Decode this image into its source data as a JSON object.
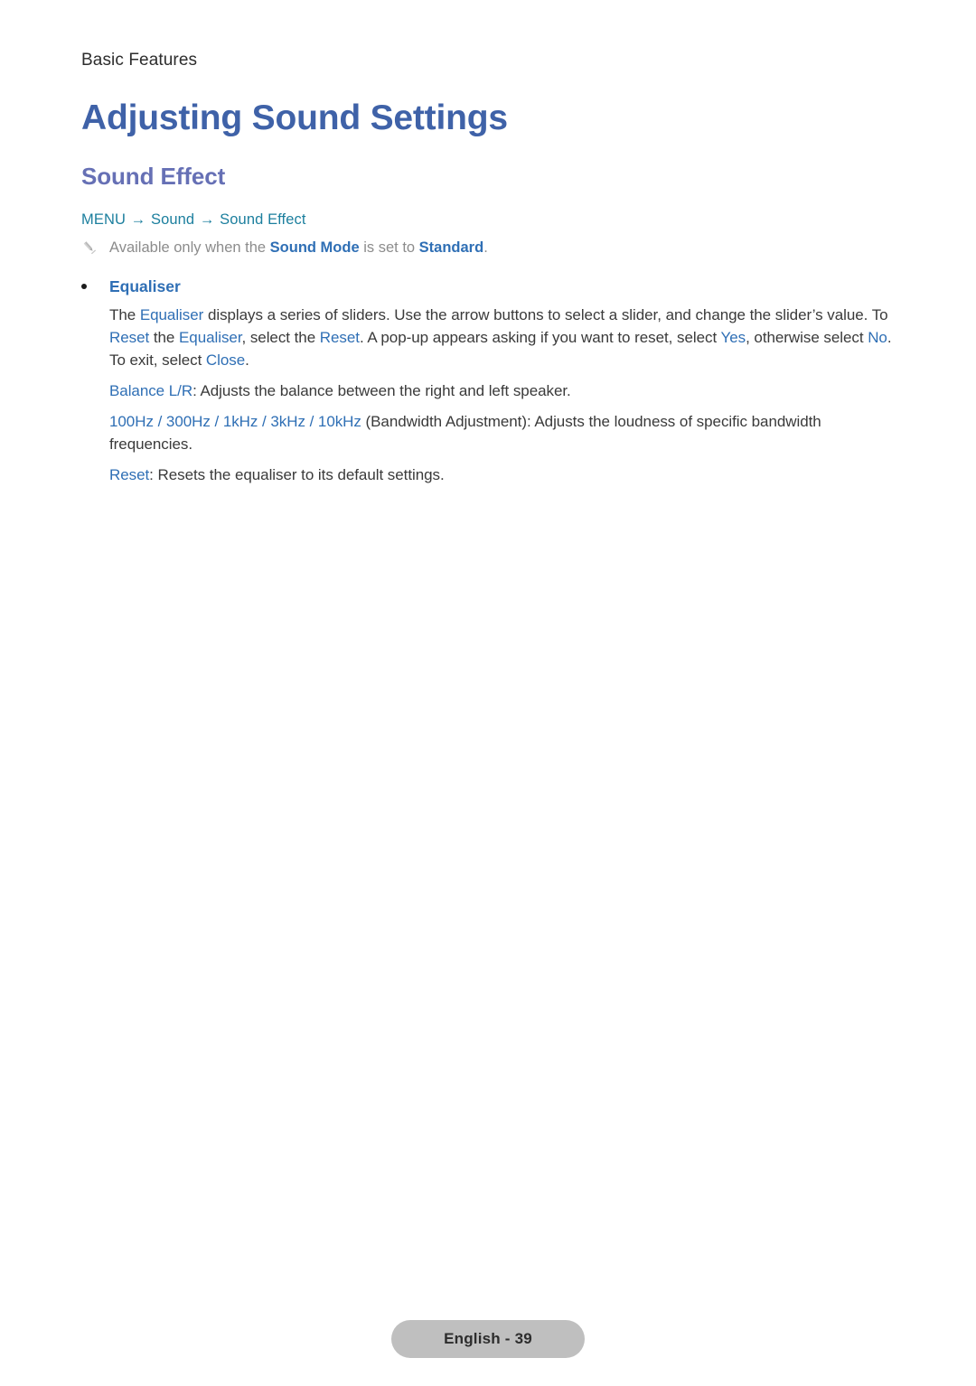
{
  "header": {
    "running_head": "Basic Features"
  },
  "title": "Adjusting Sound Settings",
  "section": {
    "heading": "Sound Effect",
    "menu_path": {
      "root": "MENU",
      "arrow1": "→",
      "level2": "Sound",
      "arrow2": "→",
      "level3": "Sound Effect"
    },
    "note": {
      "icon": "pencil-icon",
      "part1": "Available only when the ",
      "term1": "Sound Mode",
      "part2": " is set to ",
      "term2": "Standard",
      "part3": "."
    }
  },
  "items": [
    {
      "label": "Equaliser",
      "paragraphs": [
        {
          "id": "equaliser-description",
          "runs": [
            {
              "text": "The ",
              "style": "dark"
            },
            {
              "text": "Equaliser",
              "style": "blue"
            },
            {
              "text": " displays a series of sliders. Use the arrow buttons to select a slider, and change the slider’s value. To ",
              "style": "dark"
            },
            {
              "text": "Reset",
              "style": "blue"
            },
            {
              "text": " the ",
              "style": "dark"
            },
            {
              "text": "Equaliser",
              "style": "blue"
            },
            {
              "text": ", select the ",
              "style": "dark"
            },
            {
              "text": "Reset",
              "style": "blue"
            },
            {
              "text": ". A pop-up appears asking if you want to reset, select ",
              "style": "dark"
            },
            {
              "text": "Yes",
              "style": "blue"
            },
            {
              "text": ", otherwise select ",
              "style": "dark"
            },
            {
              "text": "No",
              "style": "blue"
            },
            {
              "text": ". To exit, select ",
              "style": "dark"
            },
            {
              "text": "Close",
              "style": "blue"
            },
            {
              "text": ".",
              "style": "dark"
            }
          ]
        },
        {
          "id": "balance-description",
          "runs": [
            {
              "text": "Balance L/R",
              "style": "blue"
            },
            {
              "text": ": Adjusts the balance between the right and left speaker.",
              "style": "dark"
            }
          ]
        },
        {
          "id": "bandwidth-description",
          "runs": [
            {
              "text": "100Hz / 300Hz / 1kHz / 3kHz / 10kHz",
              "style": "blue"
            },
            {
              "text": " (Bandwidth Adjustment): Adjusts the loudness of specific bandwidth frequencies.",
              "style": "dark"
            }
          ]
        },
        {
          "id": "reset-description",
          "runs": [
            {
              "text": "Reset",
              "style": "blue"
            },
            {
              "text": ": Resets the equaliser to its default settings.",
              "style": "dark"
            }
          ]
        }
      ]
    }
  ],
  "footer": {
    "page_badge": "English - 39"
  },
  "colors": {
    "title_blue": "#3f62a8",
    "heading_purple": "#6670b5",
    "menu_teal": "#1c7f9e",
    "term_blue": "#2f6fb5",
    "body_text": "#3a3a3a",
    "note_gray": "#8c8c8c",
    "badge_gray": "#bfbfbf"
  }
}
